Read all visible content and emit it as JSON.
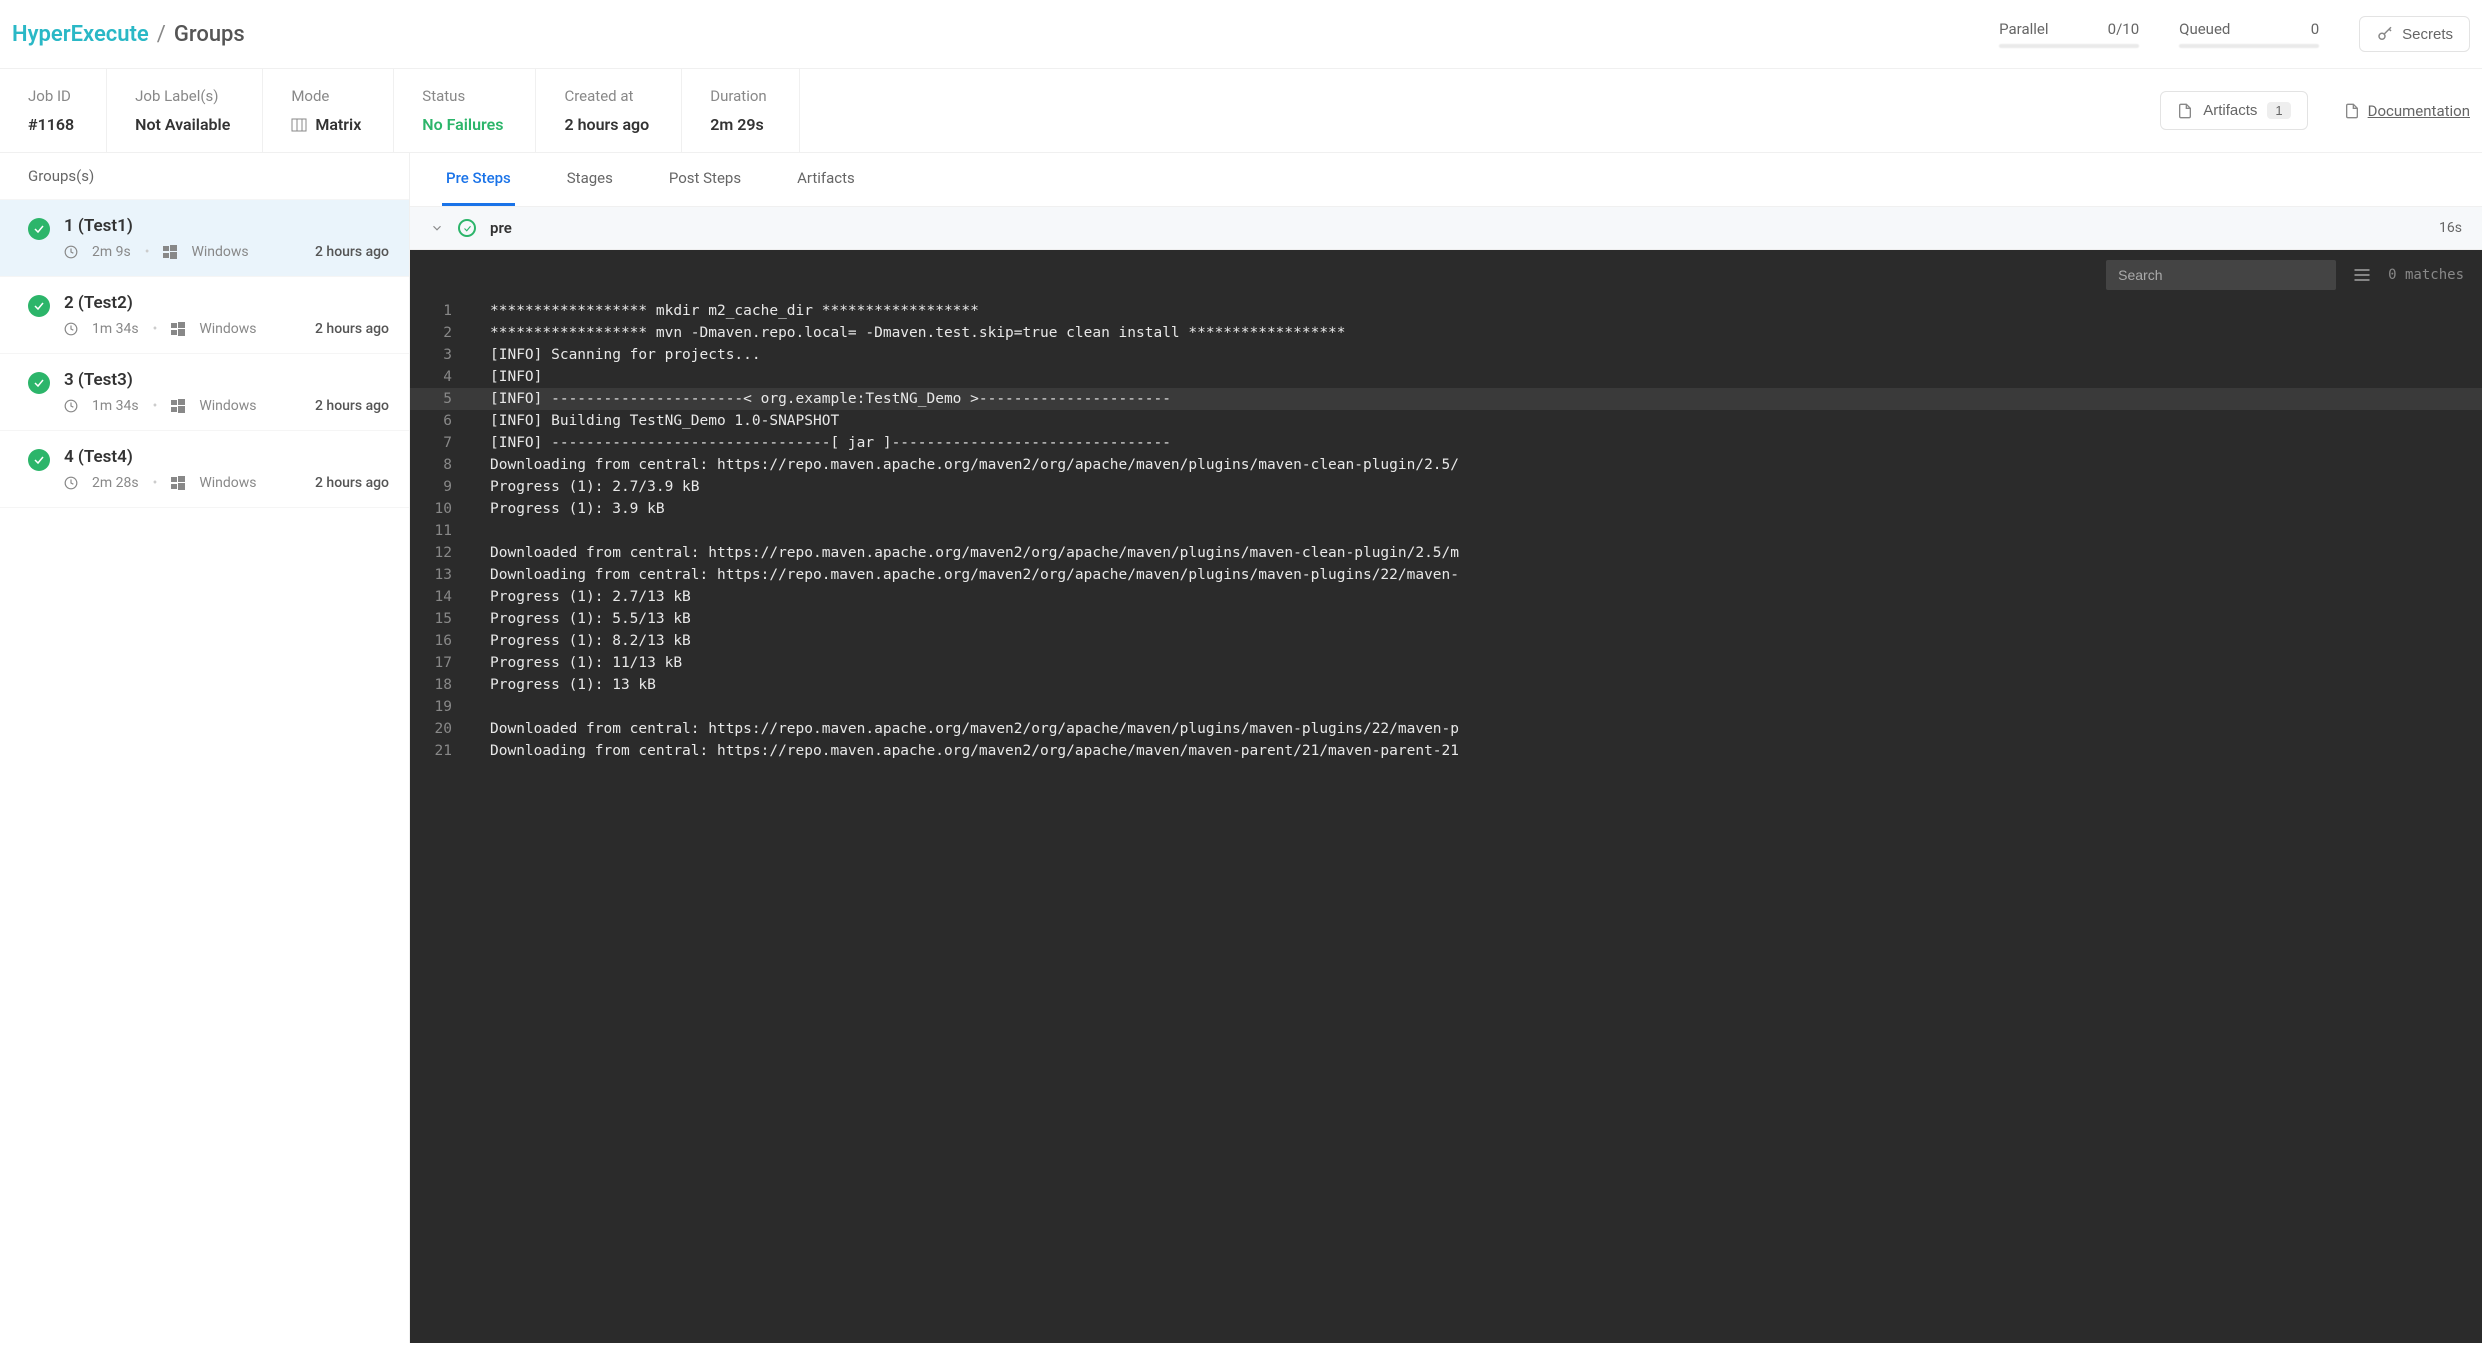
{
  "header": {
    "brand": "HyperExecute",
    "sep": "/",
    "page": "Groups",
    "parallel_label": "Parallel",
    "parallel_value": "0/10",
    "queued_label": "Queued",
    "queued_value": "0",
    "secrets_label": "Secrets"
  },
  "meta": {
    "job_id_label": "Job ID",
    "job_id_value": "#1168",
    "job_labels_label": "Job Label(s)",
    "job_labels_value": "Not Available",
    "mode_label": "Mode",
    "mode_value": "Matrix",
    "status_label": "Status",
    "status_value": "No Failures",
    "created_label": "Created at",
    "created_value": "2 hours ago",
    "duration_label": "Duration",
    "duration_value": "2m 29s",
    "artifacts_label": "Artifacts",
    "artifacts_count": "1",
    "doc_label": "Documentation"
  },
  "sidebar": {
    "heading": "Groups(s)",
    "items": [
      {
        "title": "1 (Test1)",
        "duration": "2m 9s",
        "os": "Windows",
        "timeago": "2 hours ago"
      },
      {
        "title": "2 (Test2)",
        "duration": "1m 34s",
        "os": "Windows",
        "timeago": "2 hours ago"
      },
      {
        "title": "3 (Test3)",
        "duration": "1m 34s",
        "os": "Windows",
        "timeago": "2 hours ago"
      },
      {
        "title": "4 (Test4)",
        "duration": "2m 28s",
        "os": "Windows",
        "timeago": "2 hours ago"
      }
    ]
  },
  "tabs": {
    "pre": "Pre Steps",
    "stages": "Stages",
    "post": "Post Steps",
    "artifacts": "Artifacts"
  },
  "step": {
    "name": "pre",
    "time": "16s"
  },
  "console": {
    "search_placeholder": "Search",
    "matches": "0 matches",
    "highlight_line": 5,
    "lines": [
      "****************** mkdir m2_cache_dir ******************",
      "****************** mvn -Dmaven.repo.local= -Dmaven.test.skip=true clean install ******************",
      "[INFO] Scanning for projects...",
      "[INFO]",
      "[INFO] ----------------------< org.example:TestNG_Demo >----------------------",
      "[INFO] Building TestNG_Demo 1.0-SNAPSHOT",
      "[INFO] --------------------------------[ jar ]--------------------------------",
      "Downloading from central: https://repo.maven.apache.org/maven2/org/apache/maven/plugins/maven-clean-plugin/2.5/",
      "Progress (1): 2.7/3.9 kB",
      "Progress (1): 3.9 kB",
      "",
      "Downloaded from central: https://repo.maven.apache.org/maven2/org/apache/maven/plugins/maven-clean-plugin/2.5/m",
      "Downloading from central: https://repo.maven.apache.org/maven2/org/apache/maven/plugins/maven-plugins/22/maven-",
      "Progress (1): 2.7/13 kB",
      "Progress (1): 5.5/13 kB",
      "Progress (1): 8.2/13 kB",
      "Progress (1): 11/13 kB",
      "Progress (1): 13 kB",
      "",
      "Downloaded from central: https://repo.maven.apache.org/maven2/org/apache/maven/plugins/maven-plugins/22/maven-p",
      "Downloading from central: https://repo.maven.apache.org/maven2/org/apache/maven/maven-parent/21/maven-parent-21"
    ]
  }
}
